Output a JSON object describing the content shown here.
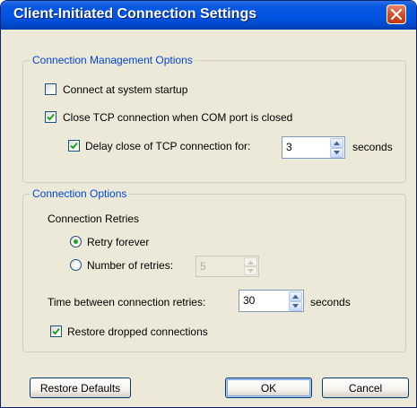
{
  "window": {
    "title": "Client-Initiated Connection Settings"
  },
  "connection_management": {
    "legend": "Connection Management Options",
    "connect_at_startup": {
      "label": "Connect at system startup",
      "checked": false
    },
    "close_tcp_on_com_close": {
      "label": "Close TCP connection when COM port is closed",
      "checked": true
    },
    "delay_close": {
      "label": "Delay close of TCP connection for:",
      "checked": true,
      "value": "3",
      "unit": "seconds"
    }
  },
  "connection_options": {
    "legend": "Connection Options",
    "retries_label": "Connection Retries",
    "retry_forever": {
      "label": "Retry forever",
      "selected": true
    },
    "number_of_retries": {
      "label": "Number of retries:",
      "selected": false,
      "value": "5"
    },
    "time_between": {
      "label": "Time between connection retries:",
      "value": "30",
      "unit": "seconds"
    },
    "restore_dropped": {
      "label": "Restore dropped connections",
      "checked": true
    }
  },
  "buttons": {
    "restore_defaults": "Restore Defaults",
    "ok": "OK",
    "cancel": "Cancel"
  },
  "colors": {
    "title_bar": "#0054e3",
    "group_legend": "#0046d5",
    "check_mark": "#21a121",
    "dialog_bg": "#ece9d8"
  }
}
